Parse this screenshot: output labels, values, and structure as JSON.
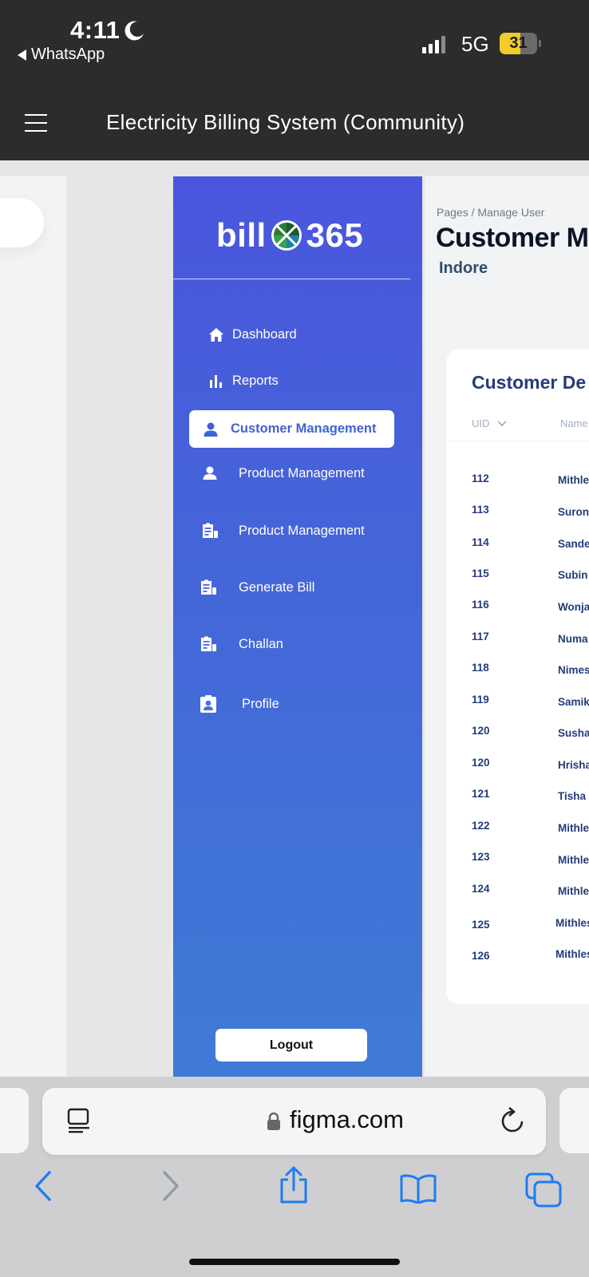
{
  "status_bar": {
    "time": "4:11",
    "back_app": "WhatsApp",
    "network": "5G",
    "battery": "31",
    "battery_level": 0.31
  },
  "toolbar": {
    "title": "Electricity Billing System (Community)"
  },
  "logo": {
    "left": "bill",
    "right": "365"
  },
  "sidebar": {
    "items": [
      {
        "label": "Dashboard",
        "icon": "home-icon"
      },
      {
        "label": "Reports",
        "icon": "bar-chart-icon"
      },
      {
        "label": "Customer Management",
        "icon": "user-icon",
        "active": true
      },
      {
        "label": "Product Management",
        "icon": "user-icon"
      },
      {
        "label": "Product Management",
        "icon": "clipboard-icon"
      },
      {
        "label": "Generate Bill",
        "icon": "clipboard-icon"
      },
      {
        "label": "Challan",
        "icon": "clipboard-icon"
      },
      {
        "label": "Profile",
        "icon": "id-badge-icon"
      }
    ],
    "logout": "Logout"
  },
  "main": {
    "breadcrumb": "Pages / Manage User",
    "title": "Customer M",
    "city": "Indore",
    "card_title": "Customer De",
    "columns": [
      "UID",
      "Name"
    ],
    "rows": [
      {
        "uid": "112",
        "name": "Mithles"
      },
      {
        "uid": "113",
        "name": "Suron N"
      },
      {
        "uid": "114",
        "name": "Sandes"
      },
      {
        "uid": "115",
        "name": "Subin S"
      },
      {
        "uid": "116",
        "name": "Wonjal"
      },
      {
        "uid": "117",
        "name": "Numa L"
      },
      {
        "uid": "118",
        "name": "Nimesh"
      },
      {
        "uid": "119",
        "name": "Samiks"
      },
      {
        "uid": "120",
        "name": "Sushan"
      },
      {
        "uid": "120",
        "name": "Hrishav"
      },
      {
        "uid": "121",
        "name": "Tisha J"
      },
      {
        "uid": "122",
        "name": "Mithles"
      },
      {
        "uid": "123",
        "name": "Mithles"
      },
      {
        "uid": "124",
        "name": "Mithles"
      },
      {
        "uid": "125",
        "name": "Mithlesl"
      },
      {
        "uid": "126",
        "name": "Mithlesl"
      }
    ]
  },
  "browser": {
    "url": "figma.com"
  },
  "colors": {
    "sidebar_top": "#4a56dd",
    "sidebar_bottom": "#3f7bd6",
    "accent_text": "#253b7a",
    "ios_blue": "#1e7cf2"
  }
}
